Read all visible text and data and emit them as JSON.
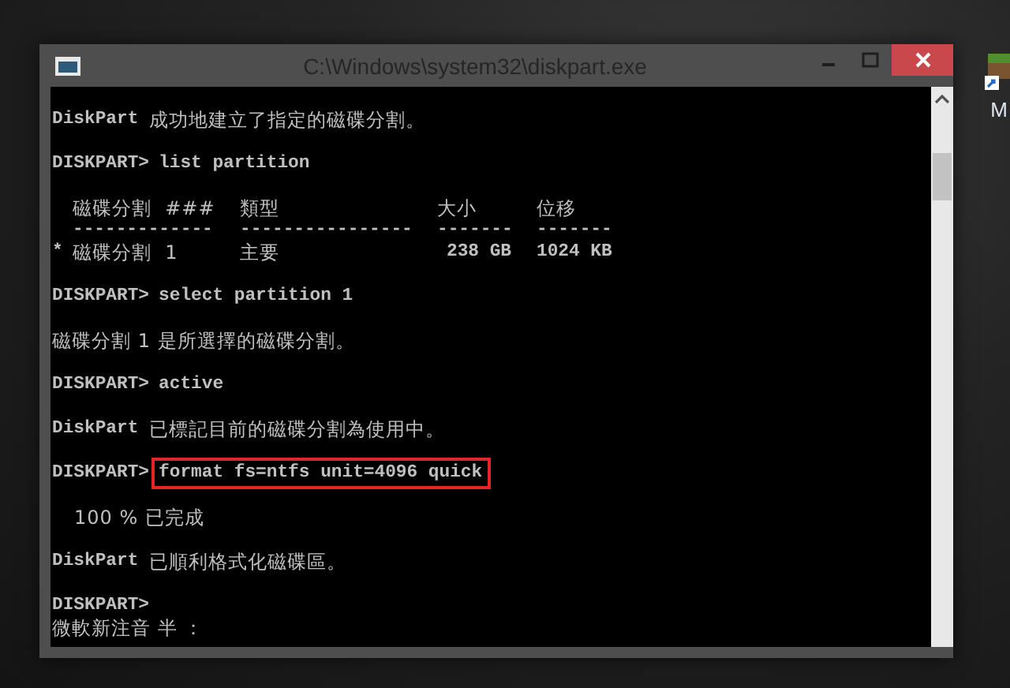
{
  "window": {
    "title": "C:\\Windows\\system32\\diskpart.exe"
  },
  "console": {
    "blocks": [
      {
        "kind": "output",
        "label": "DiskPart",
        "text": "成功地建立了指定的磁碟分割。"
      },
      {
        "kind": "command",
        "prompt": "DISKPART>",
        "command": "list partition",
        "highlighted": false
      },
      {
        "kind": "table",
        "columns": [
          {
            "label": "磁碟分割  ###",
            "rule": "-------------"
          },
          {
            "label": "類型",
            "rule": "----------------"
          },
          {
            "label": "大小",
            "rule": "-------"
          },
          {
            "label": "位移",
            "rule": "-------"
          }
        ],
        "rows": [
          {
            "marker": "*",
            "cells": [
              "磁碟分割  1",
              "主要",
              "238 GB",
              "1024 KB"
            ]
          }
        ]
      },
      {
        "kind": "command",
        "prompt": "DISKPART>",
        "command": "select partition 1",
        "highlighted": false
      },
      {
        "kind": "output",
        "text": "磁碟分割 1 是所選擇的磁碟分割。"
      },
      {
        "kind": "command",
        "prompt": "DISKPART>",
        "command": "active",
        "highlighted": false
      },
      {
        "kind": "output",
        "label": "DiskPart",
        "text": "已標記目前的磁碟分割為使用中。"
      },
      {
        "kind": "command",
        "prompt": "DISKPART>",
        "command": "format fs=ntfs unit=4096 quick",
        "highlighted": true
      },
      {
        "kind": "progress",
        "text": "100 % 已完成"
      },
      {
        "kind": "output",
        "label": "DiskPart",
        "text": "已順利格式化磁碟區。"
      },
      {
        "kind": "command",
        "prompt": "DISKPART>"
      }
    ],
    "ime_status": "微軟新注音 半 ："
  },
  "desktop_icons": [
    {
      "label": "M"
    }
  ]
}
